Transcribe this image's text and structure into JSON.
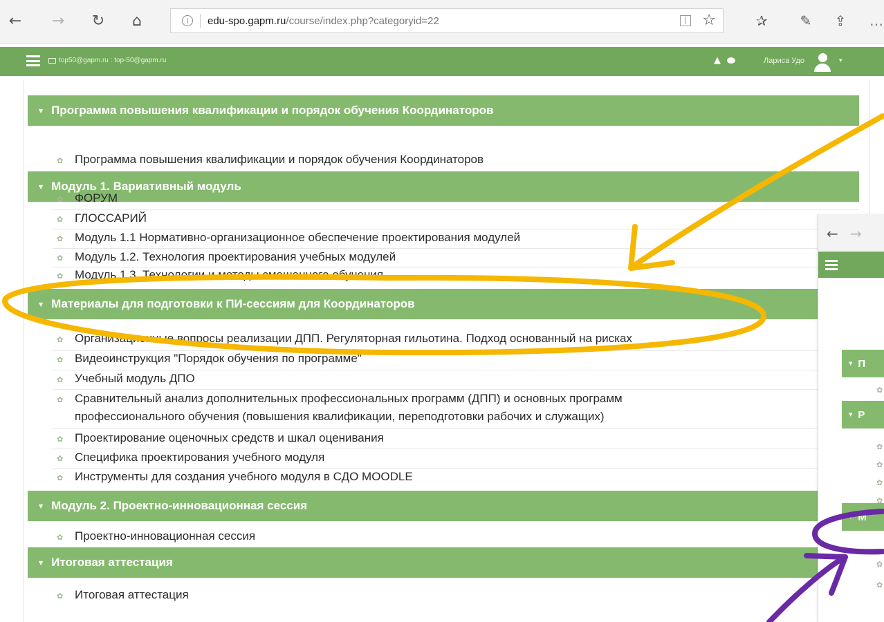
{
  "browser": {
    "url_host": "edu-spo.gapm.ru",
    "url_path": "/course/index.php?categoryid=22",
    "back_glyph": "←",
    "forward_glyph": "→",
    "refresh_glyph": "↻",
    "home_glyph": "⌂",
    "info_glyph": "i",
    "favorite_glyph": "☆",
    "favorites_bar_glyph": "✰",
    "pen_glyph": "✎",
    "share_glyph": "⇪",
    "more_glyph": "…"
  },
  "navbar": {
    "email": "top50@gapm.ru : top-50@gapm.ru",
    "user_name": "Лариса Удо",
    "bell_glyph": "▲",
    "caret_glyph": "▾"
  },
  "sections": [
    {
      "title": "Программа повышения квалификации и порядок обучения Координаторов",
      "items": [
        "Программа повышения квалификации и порядок обучения Координаторов"
      ]
    },
    {
      "title": "Модуль 1. Вариативный модуль",
      "items": [
        "ФОРУМ",
        "ГЛОССАРИЙ",
        "Модуль 1.1 Нормативно-организационное обеспечение проектирования модулей",
        "Модуль 1.2. Технология проектирования учебных модулей",
        "Модуль 1.3. Технологии и методы смешанного обучения"
      ]
    },
    {
      "title": "Материалы для подготовки к ПИ-сессиям для Координаторов",
      "items": [
        "Организационные вопросы реализации ДПП. Регуляторная гильотина. Подход основанный на рисках",
        "Видеоинструкция \"Порядок обучения по программе\"",
        "Учебный модуль ДПО",
        "Сравнительный анализ дополнительных профессиональных программ (ДПП) и основных программ",
        "профессионального обучения (повышения квалификации, переподготовки рабочих и служащих)",
        "Проектирование оценочных средств и шкал оценивания",
        "Специфика проектирования учебного модуля",
        "Инструменты для создания учебного модуля в СДО MOODLE"
      ]
    },
    {
      "title": "Модуль 2. Проектно-инновационная сессия",
      "items": [
        "Проектно-инновационная сессия"
      ]
    },
    {
      "title": "Итоговая аттестация",
      "items": [
        "Итоговая аттестация"
      ]
    }
  ],
  "icons": {
    "section_caret": "▼",
    "course_item": "✿"
  },
  "overlay": {
    "back_glyph": "←",
    "forward_glyph": "→",
    "section_letters": [
      "П",
      "Р",
      "М"
    ]
  },
  "colors": {
    "navbar": "#72a85b",
    "section_header": "#85ba6e",
    "annotation_yellow": "#f5b700",
    "annotation_purple": "#6a2aa6"
  }
}
